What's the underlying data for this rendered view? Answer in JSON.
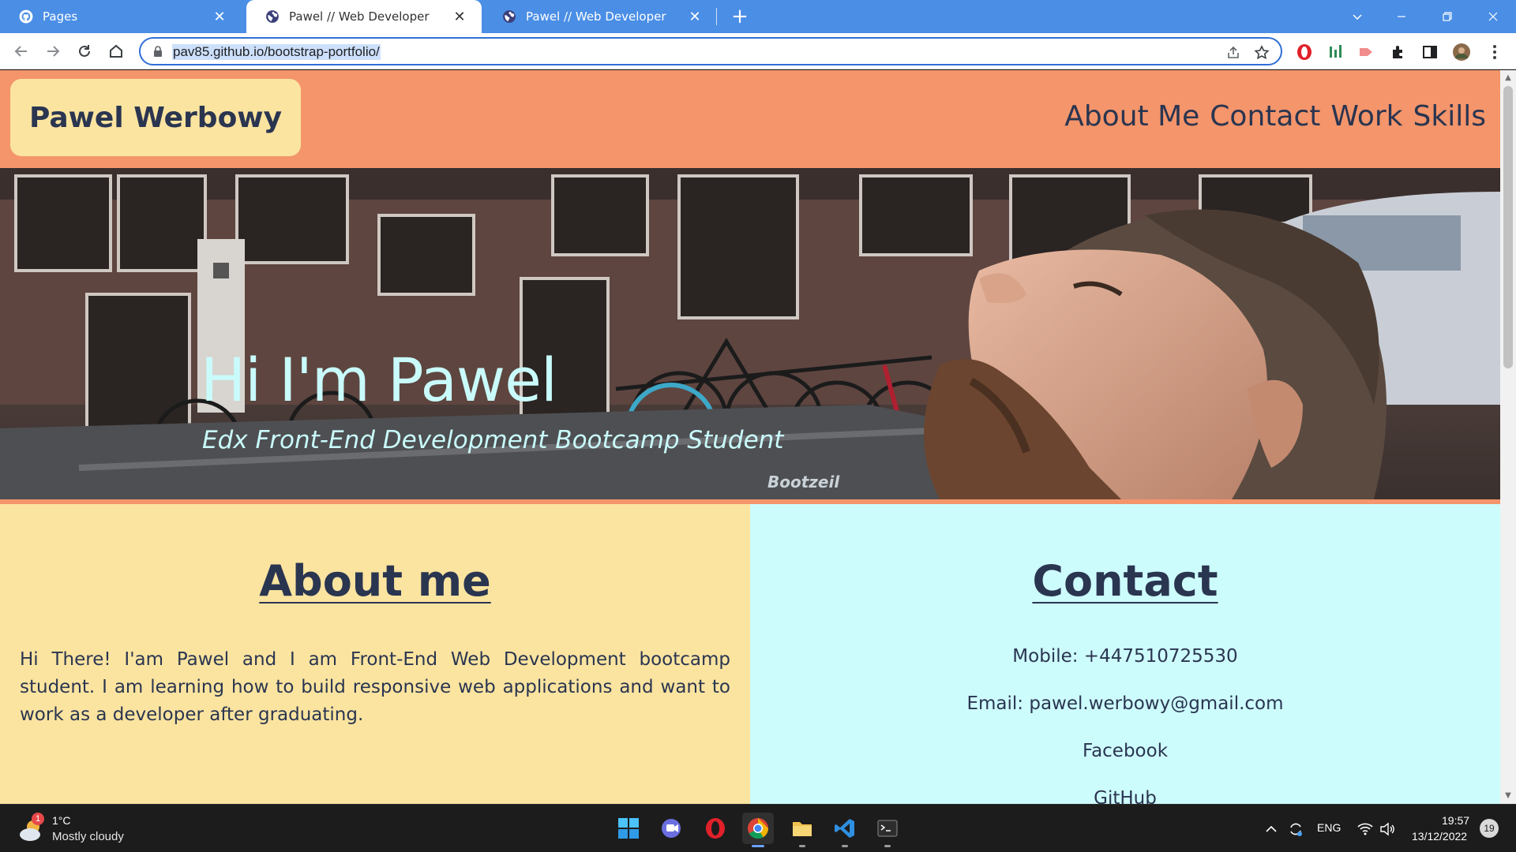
{
  "browser": {
    "tabs": [
      {
        "label": "Pages",
        "icon": "github-icon",
        "active": false
      },
      {
        "label": "Pawel // Web Developer",
        "icon": "globe-icon",
        "active": true
      },
      {
        "label": "Pawel // Web Developer",
        "icon": "globe-icon",
        "active": false
      }
    ],
    "tab_close": "✕",
    "new_tab": "+",
    "url": "pav85.github.io/bootstrap-portfolio/"
  },
  "site": {
    "brand": "Pawel Werbowy",
    "nav": [
      "About Me",
      "Contact",
      "Work",
      "Skills"
    ],
    "hero": {
      "title": "Hi I'm Pawel",
      "subtitle": "Edx Front-End Development Bootcamp Student",
      "photo_text": "Bootzeil"
    },
    "about": {
      "title": "About me",
      "text": "Hi There! I'am Pawel and I am Front-End Web Development bootcamp student. I am learning how to build responsive web applications and want to work as a developer after graduating."
    },
    "contact": {
      "title": "Contact",
      "mobile": "Mobile: +447510725530",
      "email": "Email: pawel.werbowy@gmail.com",
      "facebook": "Facebook",
      "github": "GitHub"
    }
  },
  "taskbar": {
    "weather_temp": "1°C",
    "weather_desc": "Mostly cloudy",
    "weather_badge": "1",
    "language": "ENG",
    "time": "19:57",
    "date": "13/12/2022",
    "notifications": "19"
  },
  "colors": {
    "header_bg": "#f4956b",
    "about_bg": "#fbe4a0",
    "contact_bg": "#cdfcfd",
    "text": "#2a3550",
    "hero_text": "#c9fbfb",
    "browser_accent": "#4a8ee6"
  }
}
